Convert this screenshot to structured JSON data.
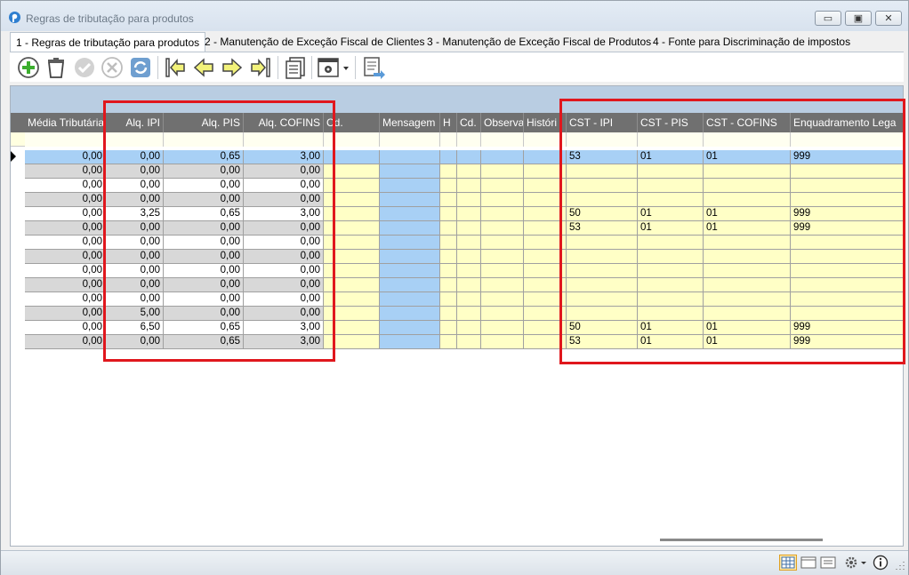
{
  "window": {
    "title": "Regras de tributação para produtos"
  },
  "tabs": [
    {
      "label": "1 - Regras de tributação para produtos",
      "active": true
    },
    {
      "label": "2 - Manutenção de Exceção Fiscal de Clientes",
      "active": false
    },
    {
      "label": "3 - Manutenção de Exceção Fiscal de Produtos",
      "active": false
    },
    {
      "label": "4 - Fonte para Discriminação de impostos",
      "active": false
    }
  ],
  "toolbar": {
    "icons": [
      "add-icon",
      "delete-icon",
      "confirm-icon",
      "cancel-icon",
      "refresh-icon",
      "first-record-icon",
      "previous-record-icon",
      "next-record-icon",
      "last-record-icon",
      "copy-icon",
      "settings-dropdown-icon",
      "export-icon"
    ]
  },
  "grid": {
    "columns": [
      {
        "key": "media",
        "label": "Média Tributária",
        "align": "right",
        "bg": "#ffffff"
      },
      {
        "key": "ipi",
        "label": "Alq. IPI",
        "align": "right",
        "bg": "#ffffff"
      },
      {
        "key": "pis",
        "label": "Alq. PIS",
        "align": "right",
        "bg": "#ffffff"
      },
      {
        "key": "cofins",
        "label": "Alq. COFINS",
        "align": "right",
        "bg": "#ffffff"
      },
      {
        "key": "cd1",
        "label": "Cd.",
        "align": "left",
        "bg": "#ffffc6"
      },
      {
        "key": "msg",
        "label": "Mensagem",
        "align": "left",
        "bg": "#a8d0f5"
      },
      {
        "key": "h",
        "label": "H",
        "align": "left",
        "bg": "#ffffc6"
      },
      {
        "key": "cd2",
        "label": "Cd.",
        "align": "left",
        "bg": "#ffffc6"
      },
      {
        "key": "obs",
        "label": "Observa",
        "align": "left",
        "bg": "#ffffc6"
      },
      {
        "key": "hist",
        "label": "Históri",
        "align": "left",
        "bg": "#ffffc6"
      },
      {
        "key": "cst_ipi",
        "label": "CST - IPI",
        "align": "left",
        "bg": "#ffffc6"
      },
      {
        "key": "cst_pis",
        "label": "CST - PIS",
        "align": "left",
        "bg": "#ffffc6"
      },
      {
        "key": "cst_cofins",
        "label": "CST - COFINS",
        "align": "left",
        "bg": "#ffffc6"
      },
      {
        "key": "enq",
        "label": "Enquadramento Lega",
        "align": "left",
        "bg": "#ffffc6"
      }
    ],
    "rows": [
      {
        "media": "0,00",
        "ipi": "0,00",
        "pis": "0,65",
        "cofins": "3,00",
        "cst_ipi": "53",
        "cst_pis": "01",
        "cst_cofins": "01",
        "enq": "999",
        "selected": true
      },
      {
        "media": "0,00",
        "ipi": "0,00",
        "pis": "0,00",
        "cofins": "0,00",
        "cst_ipi": "",
        "cst_pis": "",
        "cst_cofins": "",
        "enq": ""
      },
      {
        "media": "0,00",
        "ipi": "0,00",
        "pis": "0,00",
        "cofins": "0,00",
        "cst_ipi": "",
        "cst_pis": "",
        "cst_cofins": "",
        "enq": ""
      },
      {
        "media": "0,00",
        "ipi": "0,00",
        "pis": "0,00",
        "cofins": "0,00",
        "cst_ipi": "",
        "cst_pis": "",
        "cst_cofins": "",
        "enq": ""
      },
      {
        "media": "0,00",
        "ipi": "3,25",
        "pis": "0,65",
        "cofins": "3,00",
        "cst_ipi": "50",
        "cst_pis": "01",
        "cst_cofins": "01",
        "enq": "999"
      },
      {
        "media": "0,00",
        "ipi": "0,00",
        "pis": "0,00",
        "cofins": "0,00",
        "cst_ipi": "53",
        "cst_pis": "01",
        "cst_cofins": "01",
        "enq": "999"
      },
      {
        "media": "0,00",
        "ipi": "0,00",
        "pis": "0,00",
        "cofins": "0,00",
        "cst_ipi": "",
        "cst_pis": "",
        "cst_cofins": "",
        "enq": ""
      },
      {
        "media": "0,00",
        "ipi": "0,00",
        "pis": "0,00",
        "cofins": "0,00",
        "cst_ipi": "",
        "cst_pis": "",
        "cst_cofins": "",
        "enq": ""
      },
      {
        "media": "0,00",
        "ipi": "0,00",
        "pis": "0,00",
        "cofins": "0,00",
        "cst_ipi": "",
        "cst_pis": "",
        "cst_cofins": "",
        "enq": ""
      },
      {
        "media": "0,00",
        "ipi": "0,00",
        "pis": "0,00",
        "cofins": "0,00",
        "cst_ipi": "",
        "cst_pis": "",
        "cst_cofins": "",
        "enq": ""
      },
      {
        "media": "0,00",
        "ipi": "0,00",
        "pis": "0,00",
        "cofins": "0,00",
        "cst_ipi": "",
        "cst_pis": "",
        "cst_cofins": "",
        "enq": ""
      },
      {
        "media": "0,00",
        "ipi": "5,00",
        "pis": "0,00",
        "cofins": "0,00",
        "cst_ipi": "",
        "cst_pis": "",
        "cst_cofins": "",
        "enq": ""
      },
      {
        "media": "0,00",
        "ipi": "6,50",
        "pis": "0,65",
        "cofins": "3,00",
        "cst_ipi": "50",
        "cst_pis": "01",
        "cst_cofins": "01",
        "enq": "999"
      },
      {
        "media": "0,00",
        "ipi": "0,00",
        "pis": "0,65",
        "cofins": "3,00",
        "cst_ipi": "53",
        "cst_pis": "01",
        "cst_cofins": "01",
        "enq": "999"
      }
    ]
  },
  "statusbar": {
    "icons": [
      "grid-view-icon",
      "form-view-icon",
      "detail-view-icon",
      "settings-icon",
      "info-icon"
    ]
  },
  "colors": {
    "highlight_box": "#e0171d",
    "selected_row": "#a8d0f5",
    "alt_row": "#d8d8d8",
    "yellow_cell": "#ffffc6"
  }
}
